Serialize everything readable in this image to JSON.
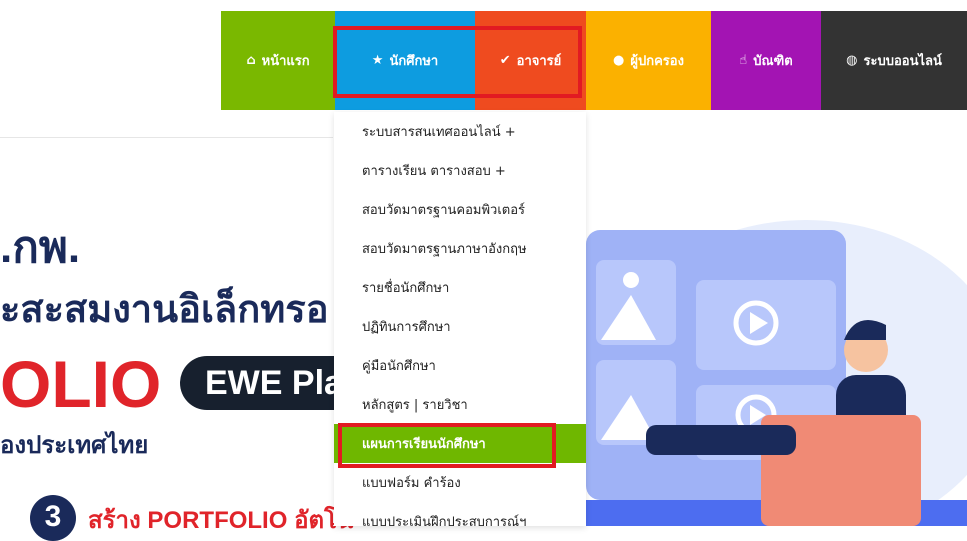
{
  "nav": {
    "items": [
      {
        "label": "หน้าแรก",
        "icon": "home-icon",
        "glyph": "⌂",
        "color": "#7ab800"
      },
      {
        "label": "นักศึกษา",
        "icon": "star-icon",
        "glyph": "★",
        "color": "#0d9ce0"
      },
      {
        "label": "อาจารย์",
        "icon": "check-icon",
        "glyph": "✔",
        "color": "#ef4b1f"
      },
      {
        "label": "ผู้ปกครอง",
        "icon": "user-icon",
        "glyph": "👤",
        "color": "#fbb100"
      },
      {
        "label": "บัณฑิต",
        "icon": "thumbs-up-icon",
        "glyph": "👍",
        "color": "#a314b3"
      },
      {
        "label": "ระบบออนไลน์",
        "icon": "globe-icon",
        "glyph": "🌐",
        "color": "#333333"
      }
    ]
  },
  "dropdown": {
    "items": [
      "ระบบสารสนเทศออนไลน์ +",
      "ตารางเรียน ตารางสอบ +",
      "สอบวัดมาตรฐานคอมพิวเตอร์",
      "สอบวัดมาตรฐานภาษาอังกฤษ",
      "รายชื่อนักศึกษา",
      "ปฏิทินการศึกษา",
      "คู่มือนักศึกษา",
      "หลักสูตร | รายวิชา",
      "แผนการเรียนนักศึกษา",
      "แบบฟอร์ม คำร้อง",
      "แบบประเมินฝึกประสบการณ์ฯ"
    ],
    "active_index": 8
  },
  "hero": {
    "line1": ".กพ.",
    "line2": "ะสะสมงานอิเล็กทรอ",
    "line3": "OLIO",
    "badge": "EWE Plat",
    "line4": "องประเทศไทย",
    "step_number": "3",
    "step_text": "สร้าง PORTFOLIO อัตโน"
  },
  "colors": {
    "highlight": "#e21a22",
    "active_item": "#6fb700",
    "hero_dark": "#1a2a5a",
    "hero_red": "#e0242a",
    "art_blue": "#4d6df0"
  }
}
